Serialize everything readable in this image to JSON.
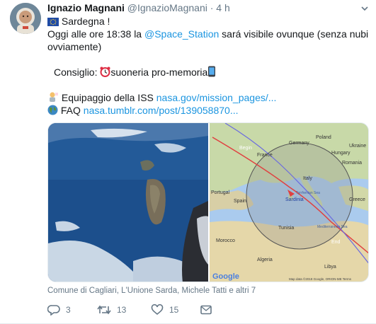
{
  "tweet": {
    "display_name": "Ignazio Magnani",
    "handle": "@IgnazioMagnani",
    "separator": "·",
    "time": "4 h",
    "lines": {
      "l1": "Sardegna !",
      "l2a": "Oggi alle ore 18:38 la ",
      "l2_mention": "@Space_Station",
      "l2b": " sará visibile ovunque (senza nubi",
      "l3": "ovviamente)",
      "l4": "Consiglio: ",
      "l4b": "suoneria pro-memoria",
      "l5a": "Equipaggio della ISS ",
      "l5_link": "nasa.gov/mission_pages/...",
      "l6a": "FAQ ",
      "l6_link": "nasa.tumblr.com/post/139058870..."
    },
    "tagged": "Comune di Cagliari, L'Unione Sarda, Michele Tatti e altri 7",
    "replies": "3",
    "retweets": "13",
    "likes": "15",
    "icons": [
      "eu-flag-icon",
      "alarm-clock-icon",
      "phone-icon",
      "astronaut-icon",
      "globe-icon",
      "reply-icon",
      "retweet-icon",
      "heart-icon",
      "message-icon",
      "chevron-down-icon"
    ]
  },
  "map": {
    "labels": {
      "begin": "Begin",
      "end": "End",
      "france": "France",
      "germany": "Germany",
      "poland": "Poland",
      "ukraine": "Ukraine",
      "hungary": "Hungary",
      "romania": "Romania",
      "portugal": "Portugal",
      "spain": "Spain",
      "italy": "Italy",
      "sardinia": "Sardinia",
      "tyrrhenian": "Tyrrhenian Sea",
      "tunisia": "Tunisia",
      "morocco": "Morocco",
      "algeria": "Algeria",
      "libya": "Libya",
      "greece": "Greece",
      "med": "Mediterranean Sea",
      "google": "Google",
      "attribution": "Map data ©2018 Google, ORION-ME   Terms"
    }
  },
  "colors": {
    "link": "#1b95e0",
    "muted": "#657786",
    "ground_track": "#e04040",
    "visibility_circle": "#555555"
  }
}
